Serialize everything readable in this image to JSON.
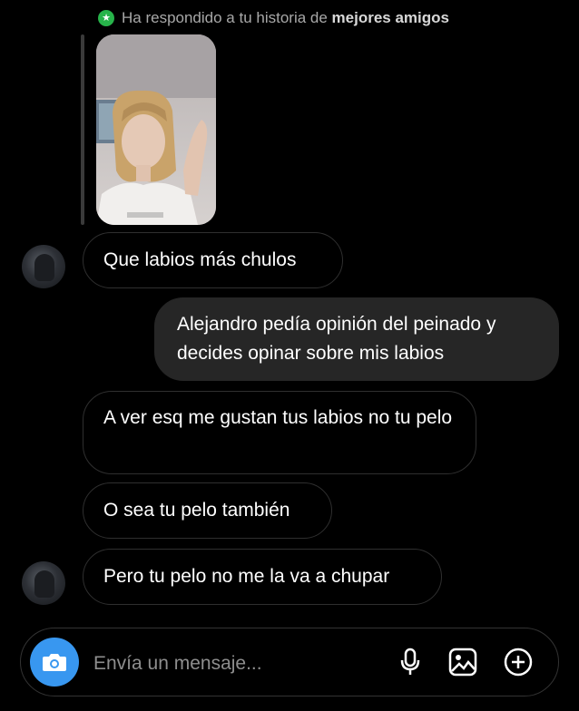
{
  "story_reply": {
    "prefix": "Ha respondido a tu historia de",
    "highlight": "mejores amigos",
    "badge_icon": "star-icon",
    "badge_color": "#27b34a"
  },
  "messages": [
    {
      "sender": "them",
      "text": "Que labios más chulos"
    },
    {
      "sender": "me",
      "text": "Alejandro pedía opinión del peinado y decides opinar sobre mis labios"
    },
    {
      "sender": "them",
      "text": "A ver esq me gustan tus labios no tu pelo"
    },
    {
      "sender": "them",
      "text": "O sea tu pelo también"
    },
    {
      "sender": "them",
      "text": "Pero tu pelo no me la va a chupar"
    }
  ],
  "composer": {
    "placeholder": "Envía un mensaje...",
    "camera_color": "#3897f0",
    "icons": [
      "camera-icon",
      "microphone-icon",
      "gallery-icon",
      "add-icon"
    ]
  }
}
